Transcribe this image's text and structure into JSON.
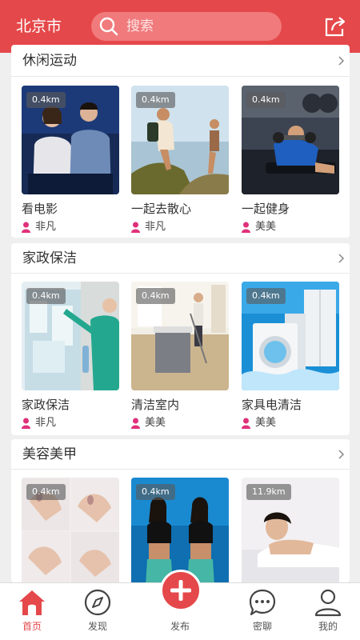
{
  "header": {
    "city": "北京市",
    "search_placeholder": "搜索",
    "share_icon": "share-icon",
    "color": "#e5484a"
  },
  "sections": [
    {
      "title": "休闲运动",
      "items": [
        {
          "title": "看电影",
          "user": "非凡",
          "distance": "0.4km",
          "image": "cinema-photo"
        },
        {
          "title": "一起去散心",
          "user": "非凡",
          "distance": "0.4km",
          "image": "hiking-photo"
        },
        {
          "title": "一起健身",
          "user": "美美",
          "distance": "0.4km",
          "image": "gym-photo"
        }
      ]
    },
    {
      "title": "家政保洁",
      "items": [
        {
          "title": "家政保洁",
          "user": "非凡",
          "distance": "0.4km",
          "image": "window-cleaning-photo"
        },
        {
          "title": "清洁室内",
          "user": "美美",
          "distance": "0.4km",
          "image": "mopping-photo"
        },
        {
          "title": "家具电清洁",
          "user": "美美",
          "distance": "0.4km",
          "image": "appliance-photo"
        }
      ]
    },
    {
      "title": "美容美甲",
      "items": [
        {
          "title": "",
          "user": "",
          "distance": "0.4km",
          "image": "nails-photo"
        },
        {
          "title": "",
          "user": "",
          "distance": "0.4km",
          "image": "fitness-models-photo"
        },
        {
          "title": "",
          "user": "",
          "distance": "11.9km",
          "image": "spa-photo"
        }
      ]
    }
  ],
  "tabbar": {
    "items": [
      {
        "label": "首页",
        "icon": "home-icon",
        "active": true
      },
      {
        "label": "发现",
        "icon": "compass-icon",
        "active": false
      },
      {
        "label": "发布",
        "icon": "plus-icon",
        "active": false
      },
      {
        "label": "密聊",
        "icon": "chat-icon",
        "active": false
      },
      {
        "label": "我的",
        "icon": "user-icon",
        "active": false
      }
    ]
  }
}
